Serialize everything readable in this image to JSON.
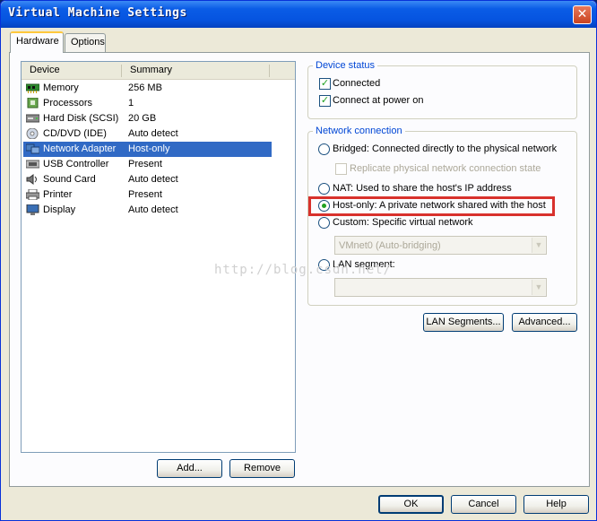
{
  "window": {
    "title": "Virtual Machine Settings",
    "close_glyph": "✕"
  },
  "tabs": [
    {
      "label": "Hardware",
      "active": true
    },
    {
      "label": "Options",
      "active": false
    }
  ],
  "device_list": {
    "headers": {
      "device": "Device",
      "summary": "Summary"
    },
    "rows": [
      {
        "device": "Memory",
        "summary": "256 MB",
        "icon": "memory-icon",
        "selected": false
      },
      {
        "device": "Processors",
        "summary": "1",
        "icon": "processor-icon",
        "selected": false
      },
      {
        "device": "Hard Disk (SCSI)",
        "summary": "20 GB",
        "icon": "hard-disk-icon",
        "selected": false
      },
      {
        "device": "CD/DVD (IDE)",
        "summary": "Auto detect",
        "icon": "cd-dvd-icon",
        "selected": false
      },
      {
        "device": "Network Adapter",
        "summary": "Host-only",
        "icon": "network-adapter-icon",
        "selected": true
      },
      {
        "device": "USB Controller",
        "summary": "Present",
        "icon": "usb-icon",
        "selected": false
      },
      {
        "device": "Sound Card",
        "summary": "Auto detect",
        "icon": "speaker-icon",
        "selected": false
      },
      {
        "device": "Printer",
        "summary": "Present",
        "icon": "printer-icon",
        "selected": false
      },
      {
        "device": "Display",
        "summary": "Auto detect",
        "icon": "monitor-icon",
        "selected": false
      }
    ]
  },
  "list_buttons": {
    "add": "Add...",
    "remove": "Remove"
  },
  "device_status": {
    "title": "Device status",
    "connected": {
      "label": "Connected",
      "checked": true
    },
    "connect_at_power_on": {
      "label": "Connect at power on",
      "checked": true
    }
  },
  "network_connection": {
    "title": "Network connection",
    "bridged": {
      "label": "Bridged: Connected directly to the physical network",
      "selected": false
    },
    "replicate": {
      "label": "Replicate physical network connection state",
      "checked": false,
      "enabled": false
    },
    "nat": {
      "label": "NAT: Used to share the host's IP address",
      "selected": false
    },
    "host_only": {
      "label": "Host-only: A private network shared with the host",
      "selected": true
    },
    "custom": {
      "label": "Custom: Specific virtual network",
      "selected": false
    },
    "custom_select": {
      "value": "VMnet0 (Auto-bridging)",
      "enabled": false
    },
    "lan_segment": {
      "label": "LAN segment:",
      "selected": false
    },
    "lan_select": {
      "value": "",
      "enabled": false
    }
  },
  "network_buttons": {
    "lan_segments": "LAN Segments...",
    "advanced": "Advanced..."
  },
  "dialog_buttons": {
    "ok": "OK",
    "cancel": "Cancel",
    "help": "Help"
  },
  "watermark": "http://blog.csdn.net/",
  "colors": {
    "highlight_box": "#d8312c",
    "selection": "#316ac5",
    "titlebar": "#0654e0",
    "group_title": "#0046d5",
    "check_mark": "#21a121"
  }
}
